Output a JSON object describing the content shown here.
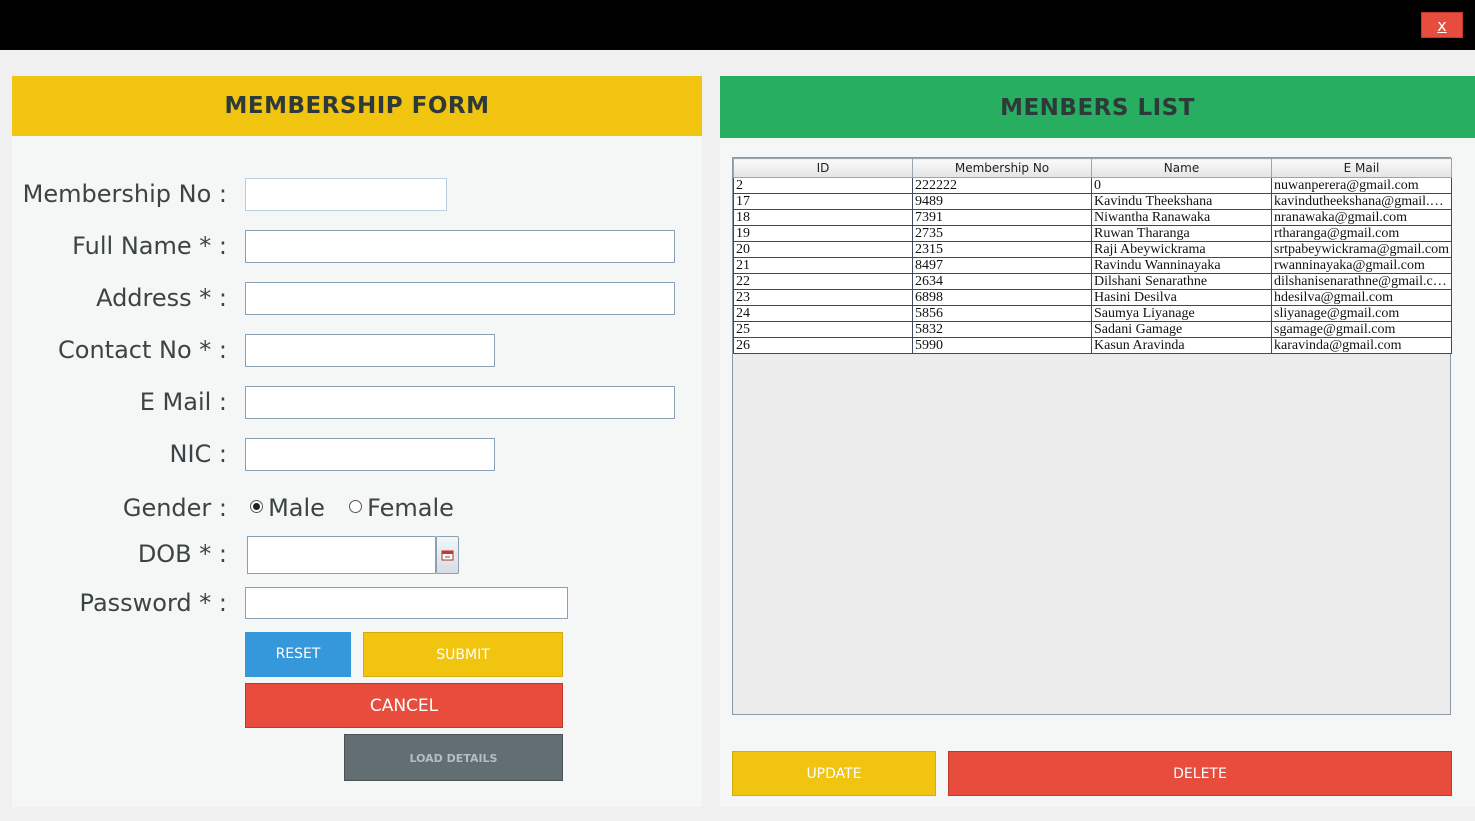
{
  "window": {
    "close_label": "x"
  },
  "form": {
    "title": "MEMBERSHIP FORM",
    "labels": {
      "membership_no": "Membership No :",
      "full_name": "Full Name * :",
      "address": "Address * :",
      "contact_no": "Contact No * :",
      "email": "E Mail :",
      "nic": "NIC :",
      "gender": "Gender :",
      "dob": "DOB * :",
      "password": "Password * :"
    },
    "values": {
      "membership_no": "",
      "full_name": "",
      "address": "",
      "contact_no": "",
      "email": "",
      "nic": "",
      "dob": "",
      "password": ""
    },
    "gender_options": {
      "male": "Male",
      "female": "Female",
      "selected": "Male"
    },
    "buttons": {
      "reset": "RESET",
      "submit": "SUBMIT",
      "cancel": "CANCEL",
      "load_details": "LOAD DETAILS"
    }
  },
  "members": {
    "title": "MENBERS LIST",
    "columns": [
      "ID",
      "Membership No",
      "Name",
      "E Mail"
    ],
    "rows": [
      [
        "2",
        "222222",
        "0",
        "nuwanperera@gmail.com"
      ],
      [
        "17",
        "9489",
        "Kavindu Theekshana",
        "kavindutheekshana@gmail.com"
      ],
      [
        "18",
        "7391",
        "Niwantha Ranawaka",
        "nranawaka@gmail.com"
      ],
      [
        "19",
        "2735",
        "Ruwan Tharanga",
        "rtharanga@gmail.com"
      ],
      [
        "20",
        "2315",
        "Raji Abeywickrama",
        "srtpabeywickrama@gmail.com"
      ],
      [
        "21",
        "8497",
        "Ravindu Wanninayaka",
        "rwanninayaka@gmail.com"
      ],
      [
        "22",
        "2634",
        "Dilshani Senarathne",
        "dilshanisenarathne@gmail.com"
      ],
      [
        "23",
        "6898",
        "Hasini Desilva",
        "hdesilva@gmail.com"
      ],
      [
        "24",
        "5856",
        "Saumya Liyanage",
        "sliyanage@gmail.com"
      ],
      [
        "25",
        "5832",
        "Sadani Gamage",
        "sgamage@gmail.com"
      ],
      [
        "26",
        "5990",
        "Kasun Aravinda",
        "karavinda@gmail.com"
      ]
    ],
    "buttons": {
      "update": "UPDATE",
      "delete": "DELETE"
    }
  },
  "colors": {
    "form_header": "#f1c40f",
    "list_header": "#27ae60",
    "reset": "#3498db",
    "submit": "#f1c40f",
    "cancel": "#e74c3c",
    "load": "#636e72"
  }
}
